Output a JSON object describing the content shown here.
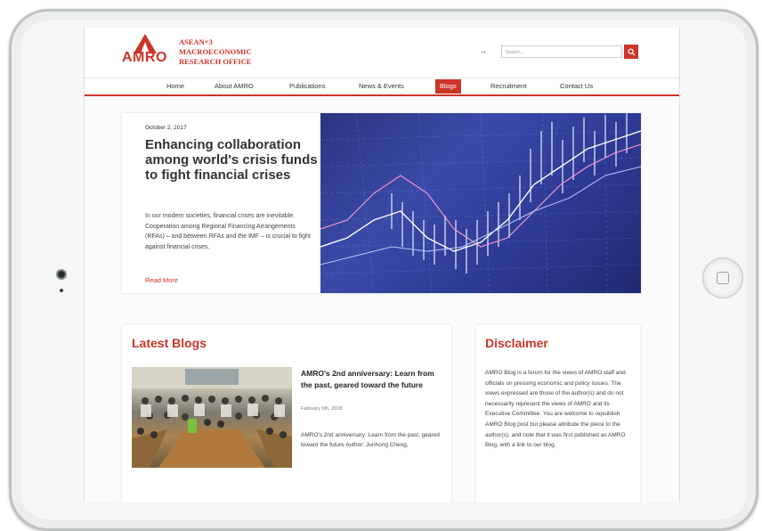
{
  "site": {
    "logo_text": "AMRO",
    "logo_sub_line1": "ASEAN+3",
    "logo_sub_line2": "MACROECONOMIC",
    "logo_sub_line3": "RESEARCH OFFICE",
    "lang_icon": "↔",
    "search_placeholder": "Search...",
    "search_icon": "search-icon",
    "accent": "#cc3428"
  },
  "nav": {
    "items": [
      {
        "label": "Home"
      },
      {
        "label": "About AMRO"
      },
      {
        "label": "Publications"
      },
      {
        "label": "News & Events"
      },
      {
        "label": "Blogs"
      },
      {
        "label": "Recruitment"
      },
      {
        "label": "Contact Us"
      }
    ],
    "active": "Blogs"
  },
  "hero": {
    "date": "October 2, 2017",
    "title": "Enhancing collaboration among world's crisis funds to fight financial crises",
    "body": "In our modern societies, financial crises are inevitable. Cooperation among Regional Financing Arrangements (RFAs) – and between RFAs and the IMF – is crucial to fight against financial crises.",
    "read_more": "Read More"
  },
  "latest_blogs": {
    "heading": "Latest Blogs",
    "post": {
      "title": "AMRO's 2nd anniversary: Learn from the past, geared toward the future",
      "date": "February 6th, 2018",
      "excerpt": "AMRO's 2nd anniversary: Learn from the past, geared toward the future Author: Junhong Cheng,"
    }
  },
  "disclaimer": {
    "heading": "Disclaimer",
    "body": "AMRO Blog is a forum for the views of AMRO staff and officials on pressing economic and policy issues. The views expressed are those of the author(s) and do not necessarily represent the views of AMRO and its Executive Committee. You are welcome to repuiblish AMRO Blog post but please attribute the piece to the author(s), and note that it was first published as AMRO Blog, with a link to our blog."
  }
}
